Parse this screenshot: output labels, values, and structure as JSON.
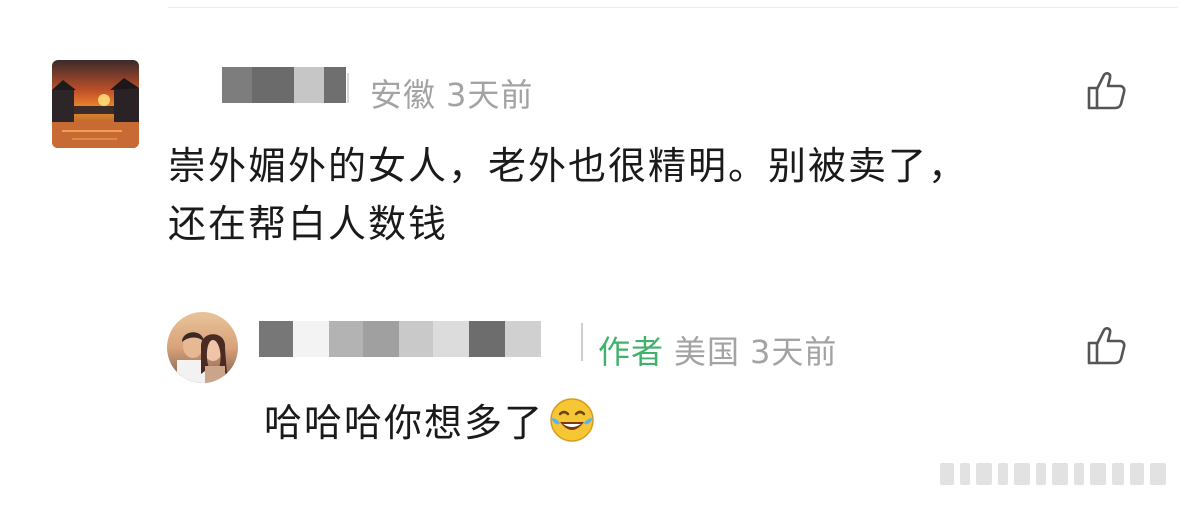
{
  "comment": {
    "name_masked": "",
    "location": "安徽",
    "time": "3天前",
    "text_line1": "崇外媚外的女人，老外也很精明。别被卖了，",
    "text_line2": "还在帮白人数钱",
    "avatar_icon": "sunset-canal-avatar",
    "like_icon": "thumbs-up-icon"
  },
  "reply": {
    "name_masked": "",
    "author_tag": "作者",
    "location": "美国",
    "time": "3天前",
    "text": "哈哈哈你想多了",
    "emoji": "laughing-tears-emoji",
    "avatar_icon": "couple-photo-avatar",
    "like_icon": "thumbs-up-icon"
  },
  "colors": {
    "author_tag": "#3fb26b",
    "meta_text": "#a3a3a3",
    "content_text": "#1a1a1a"
  }
}
